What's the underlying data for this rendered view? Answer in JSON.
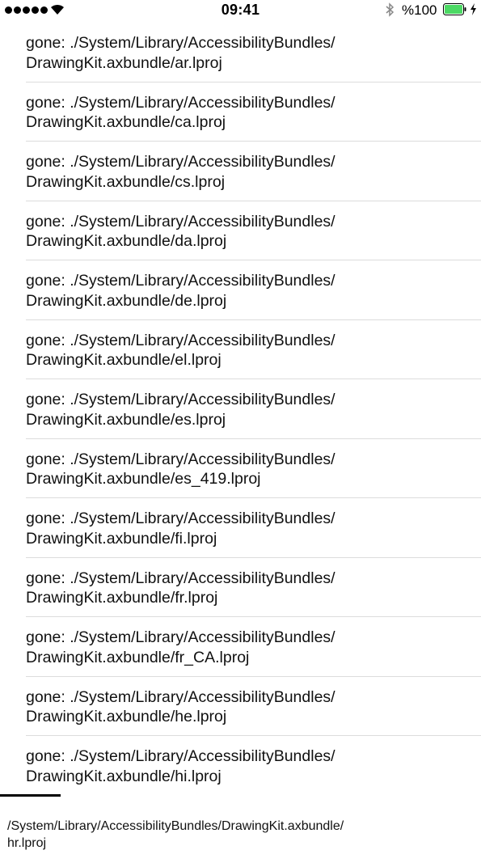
{
  "status_bar": {
    "time": "09:41",
    "battery_percent": "%100",
    "battery_level": 1.0,
    "signal_bars": 5,
    "icons": [
      "signal-icon",
      "wifi-icon",
      "bluetooth-icon",
      "battery-icon",
      "charging-icon"
    ]
  },
  "entries": [
    {
      "line1": "gone: ./System/Library/AccessibilityBundles/",
      "line2": "DrawingKit.axbundle/ar.lproj"
    },
    {
      "line1": "gone: ./System/Library/AccessibilityBundles/",
      "line2": "DrawingKit.axbundle/ca.lproj"
    },
    {
      "line1": "gone: ./System/Library/AccessibilityBundles/",
      "line2": "DrawingKit.axbundle/cs.lproj"
    },
    {
      "line1": "gone: ./System/Library/AccessibilityBundles/",
      "line2": "DrawingKit.axbundle/da.lproj"
    },
    {
      "line1": "gone: ./System/Library/AccessibilityBundles/",
      "line2": "DrawingKit.axbundle/de.lproj"
    },
    {
      "line1": "gone: ./System/Library/AccessibilityBundles/",
      "line2": "DrawingKit.axbundle/el.lproj"
    },
    {
      "line1": "gone: ./System/Library/AccessibilityBundles/",
      "line2": "DrawingKit.axbundle/es.lproj"
    },
    {
      "line1": "gone: ./System/Library/AccessibilityBundles/",
      "line2": "DrawingKit.axbundle/es_419.lproj"
    },
    {
      "line1": "gone: ./System/Library/AccessibilityBundles/",
      "line2": "DrawingKit.axbundle/fi.lproj"
    },
    {
      "line1": "gone: ./System/Library/AccessibilityBundles/",
      "line2": "DrawingKit.axbundle/fr.lproj"
    },
    {
      "line1": "gone: ./System/Library/AccessibilityBundles/",
      "line2": "DrawingKit.axbundle/fr_CA.lproj"
    },
    {
      "line1": "gone: ./System/Library/AccessibilityBundles/",
      "line2": "DrawingKit.axbundle/he.lproj"
    },
    {
      "line1": "gone: ./System/Library/AccessibilityBundles/",
      "line2": "DrawingKit.axbundle/hi.lproj"
    }
  ],
  "footer": {
    "current_path_line1": "/System/Library/AccessibilityBundles/DrawingKit.axbundle/",
    "current_path_line2": "hr.lproj"
  }
}
